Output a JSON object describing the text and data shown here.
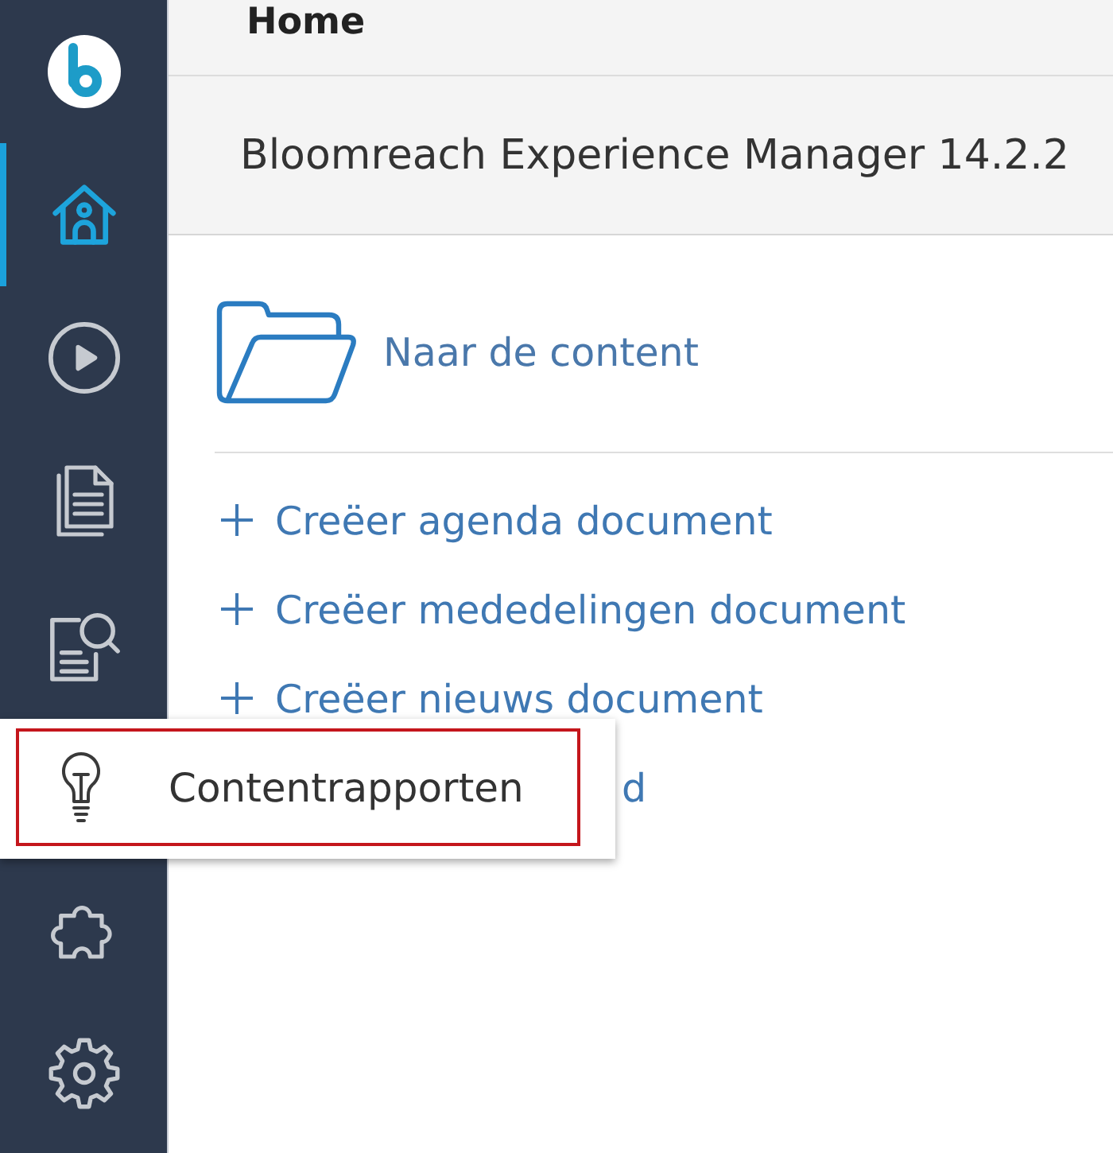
{
  "sidebar": {
    "items": [
      {
        "kind": "home",
        "selected": true,
        "expanded": false,
        "highlighted": false
      },
      {
        "kind": "play",
        "selected": false,
        "expanded": false,
        "highlighted": false
      },
      {
        "kind": "document",
        "selected": false,
        "expanded": false,
        "highlighted": false
      },
      {
        "kind": "lookup",
        "selected": false,
        "expanded": false,
        "highlighted": false
      },
      {
        "kind": "bulb",
        "selected": false,
        "expanded": true,
        "highlighted": true,
        "label": "Contentrapporten"
      },
      {
        "kind": "puzzle",
        "selected": false,
        "expanded": false,
        "highlighted": false
      },
      {
        "kind": "gear",
        "selected": false,
        "expanded": false,
        "highlighted": false
      }
    ]
  },
  "header": {
    "title": "Home"
  },
  "version_bar": {
    "text": "Bloomreach Experience Manager 14.2.2"
  },
  "content_link": {
    "label": "Naar de content"
  },
  "create_links": [
    {
      "kind": "create",
      "label": "Creëer agenda document"
    },
    {
      "kind": "create",
      "label": "Creëer mededelingen document"
    },
    {
      "kind": "create",
      "label": "Creëer nieuws document"
    },
    {
      "kind": "clipped",
      "label": "d"
    }
  ]
}
